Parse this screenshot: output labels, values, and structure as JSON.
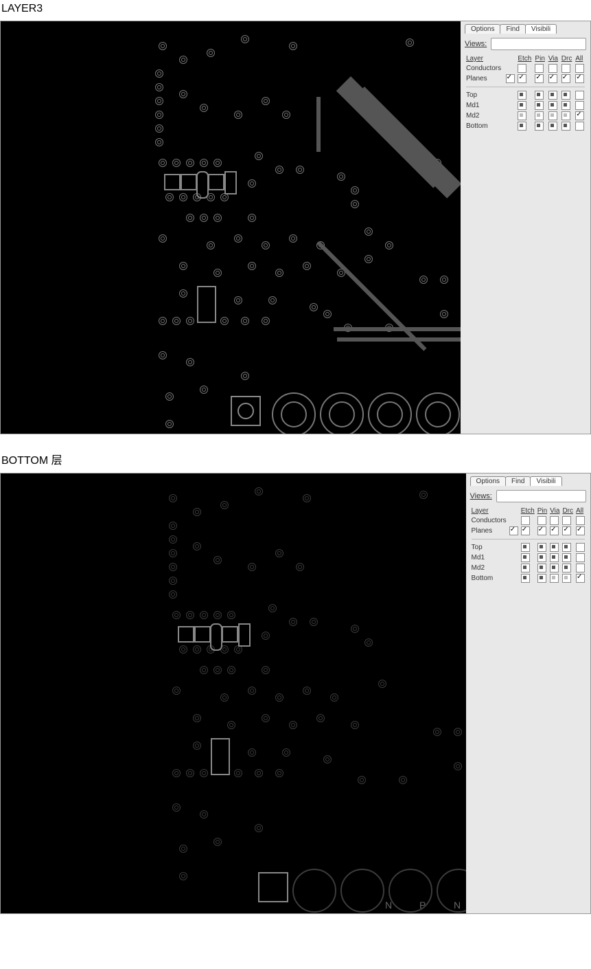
{
  "sections": {
    "layer3_title": "LAYER3",
    "bottom_title": "BOTTOM 层"
  },
  "panel1": {
    "tabs": {
      "options": "Options",
      "find": "Find",
      "visibility": "Visibili"
    },
    "views_label": "Views:",
    "headers": {
      "layer": "Layer",
      "etch": "Etch",
      "pin": "Pin",
      "via": "Via",
      "drc": "Drc",
      "all": "All"
    },
    "rows": {
      "conductors": {
        "label": "Conductors",
        "etch": false,
        "pin": false,
        "via": false,
        "drc": false,
        "all": false
      },
      "planes": {
        "label": "Planes",
        "master": true,
        "etch": true,
        "pin": true,
        "via": true,
        "drc": true,
        "all": true
      }
    },
    "layers": {
      "top": {
        "label": "Top",
        "all_chk": false
      },
      "md1": {
        "label": "Md1",
        "all_chk": false
      },
      "md2": {
        "label": "Md2",
        "all_chk": true
      },
      "bottom": {
        "label": "Bottom",
        "all_chk": false
      }
    }
  },
  "panel2": {
    "tabs": {
      "options": "Options",
      "find": "Find",
      "visibility": "Visibili"
    },
    "views_label": "Views:",
    "headers": {
      "layer": "Layer",
      "etch": "Etch",
      "pin": "Pin",
      "via": "Via",
      "drc": "Drc",
      "all": "All"
    },
    "rows": {
      "conductors": {
        "label": "Conductors",
        "etch": false,
        "pin": false,
        "via": false,
        "drc": false,
        "all": false
      },
      "planes": {
        "label": "Planes",
        "master": true,
        "etch": true,
        "pin": true,
        "via": true,
        "drc": true,
        "all": true
      }
    },
    "layers": {
      "top": {
        "label": "Top",
        "all_chk": false
      },
      "md1": {
        "label": "Md1",
        "all_chk": false
      },
      "md2": {
        "label": "Md2",
        "all_chk": false
      },
      "bottom": {
        "label": "Bottom",
        "all_chk": true
      }
    }
  }
}
